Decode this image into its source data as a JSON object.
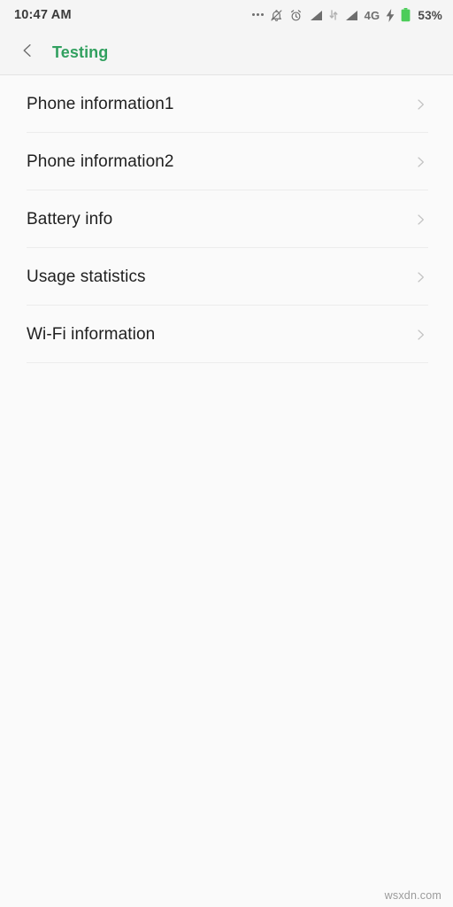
{
  "status_bar": {
    "time": "10:47 AM",
    "network_label": "4G",
    "battery_percent": "53%",
    "icons": [
      {
        "name": "more-dots-icon",
        "label": "..."
      },
      {
        "name": "bell-muted-icon",
        "label": "silent"
      },
      {
        "name": "alarm-clock-icon",
        "label": "alarm"
      },
      {
        "name": "signal-bars-sim1-icon",
        "label": "signal"
      },
      {
        "name": "data-transfer-arrows-icon",
        "label": "data"
      },
      {
        "name": "signal-bars-sim2-icon",
        "label": "signal"
      },
      {
        "name": "charging-bolt-icon",
        "label": "charging"
      },
      {
        "name": "battery-icon",
        "label": "battery"
      }
    ],
    "colors": {
      "battery_green": "#4ccd5a",
      "text": "#3a3a3a",
      "icon": "#7a7a7a",
      "background": "#f5f5f5"
    }
  },
  "header": {
    "back_label": "Back",
    "title": "Testing",
    "title_color": "#31a05f",
    "background": "#f5f5f5"
  },
  "list": {
    "items": [
      {
        "label": "Phone information1",
        "chevron": "chevron-right-icon"
      },
      {
        "label": "Phone information2",
        "chevron": "chevron-right-icon"
      },
      {
        "label": "Battery info",
        "chevron": "chevron-right-icon"
      },
      {
        "label": "Usage statistics",
        "chevron": "chevron-right-icon"
      },
      {
        "label": "Wi-Fi information",
        "chevron": "chevron-right-icon"
      }
    ],
    "divider_color": "#ececec",
    "background": "#fafafa",
    "text_color": "#1f1f1f"
  },
  "watermark": {
    "text": "wsxdn.com"
  }
}
